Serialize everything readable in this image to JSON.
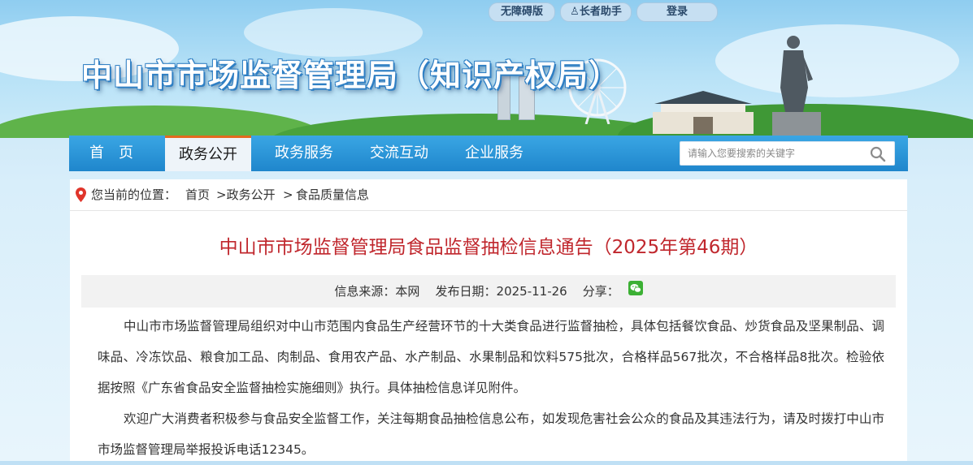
{
  "top_links": {
    "accessibility": "无障碍版",
    "elder": "长者助手",
    "login": "登录"
  },
  "site_title": "中山市市场监督管理局（知识产权局）",
  "nav": {
    "items": [
      "首　页",
      "政务公开",
      "政务服务",
      "交流互动",
      "企业服务"
    ],
    "active_index": 1
  },
  "search": {
    "placeholder": "请输入您要搜索的关键字"
  },
  "breadcrumb": {
    "prefix": "您当前的位置：",
    "items": [
      "首页",
      ">政务公开",
      ">",
      "食品质量信息"
    ]
  },
  "article": {
    "title": "中山市市场监督管理局食品监督抽检信息通告（2025年第46期）",
    "meta": {
      "source_label": "信息来源：",
      "source": "本网",
      "date_label": "发布日期：",
      "date": "2025-11-26",
      "share_label": "分享："
    },
    "paragraphs": [
      "中山市市场监督管理局组织对中山市范围内食品生产经营环节的十大类食品进行监督抽检，具体包括餐饮食品、炒货食品及坚果制品、调味品、冷冻饮品、粮食加工品、肉制品、食用农产品、水产制品、水果制品和饮料575批次，合格样品567批次，不合格样品8批次。检验依据按照《广东省食品安全监督抽检实施细则》执行。具体抽检信息详见附件。",
      "欢迎广大消费者积极参与食品安全监督工作，关注每期食品抽检信息公布，如发现危害社会公众的食品及其违法行为，请及时拨打中山市市场监督管理局举报投诉电话12345。"
    ]
  },
  "colors": {
    "nav_blue": "#1f86cc",
    "active_tab_border": "#e36a1f",
    "title_red": "#c0272d",
    "wechat_green": "#3cb034"
  }
}
